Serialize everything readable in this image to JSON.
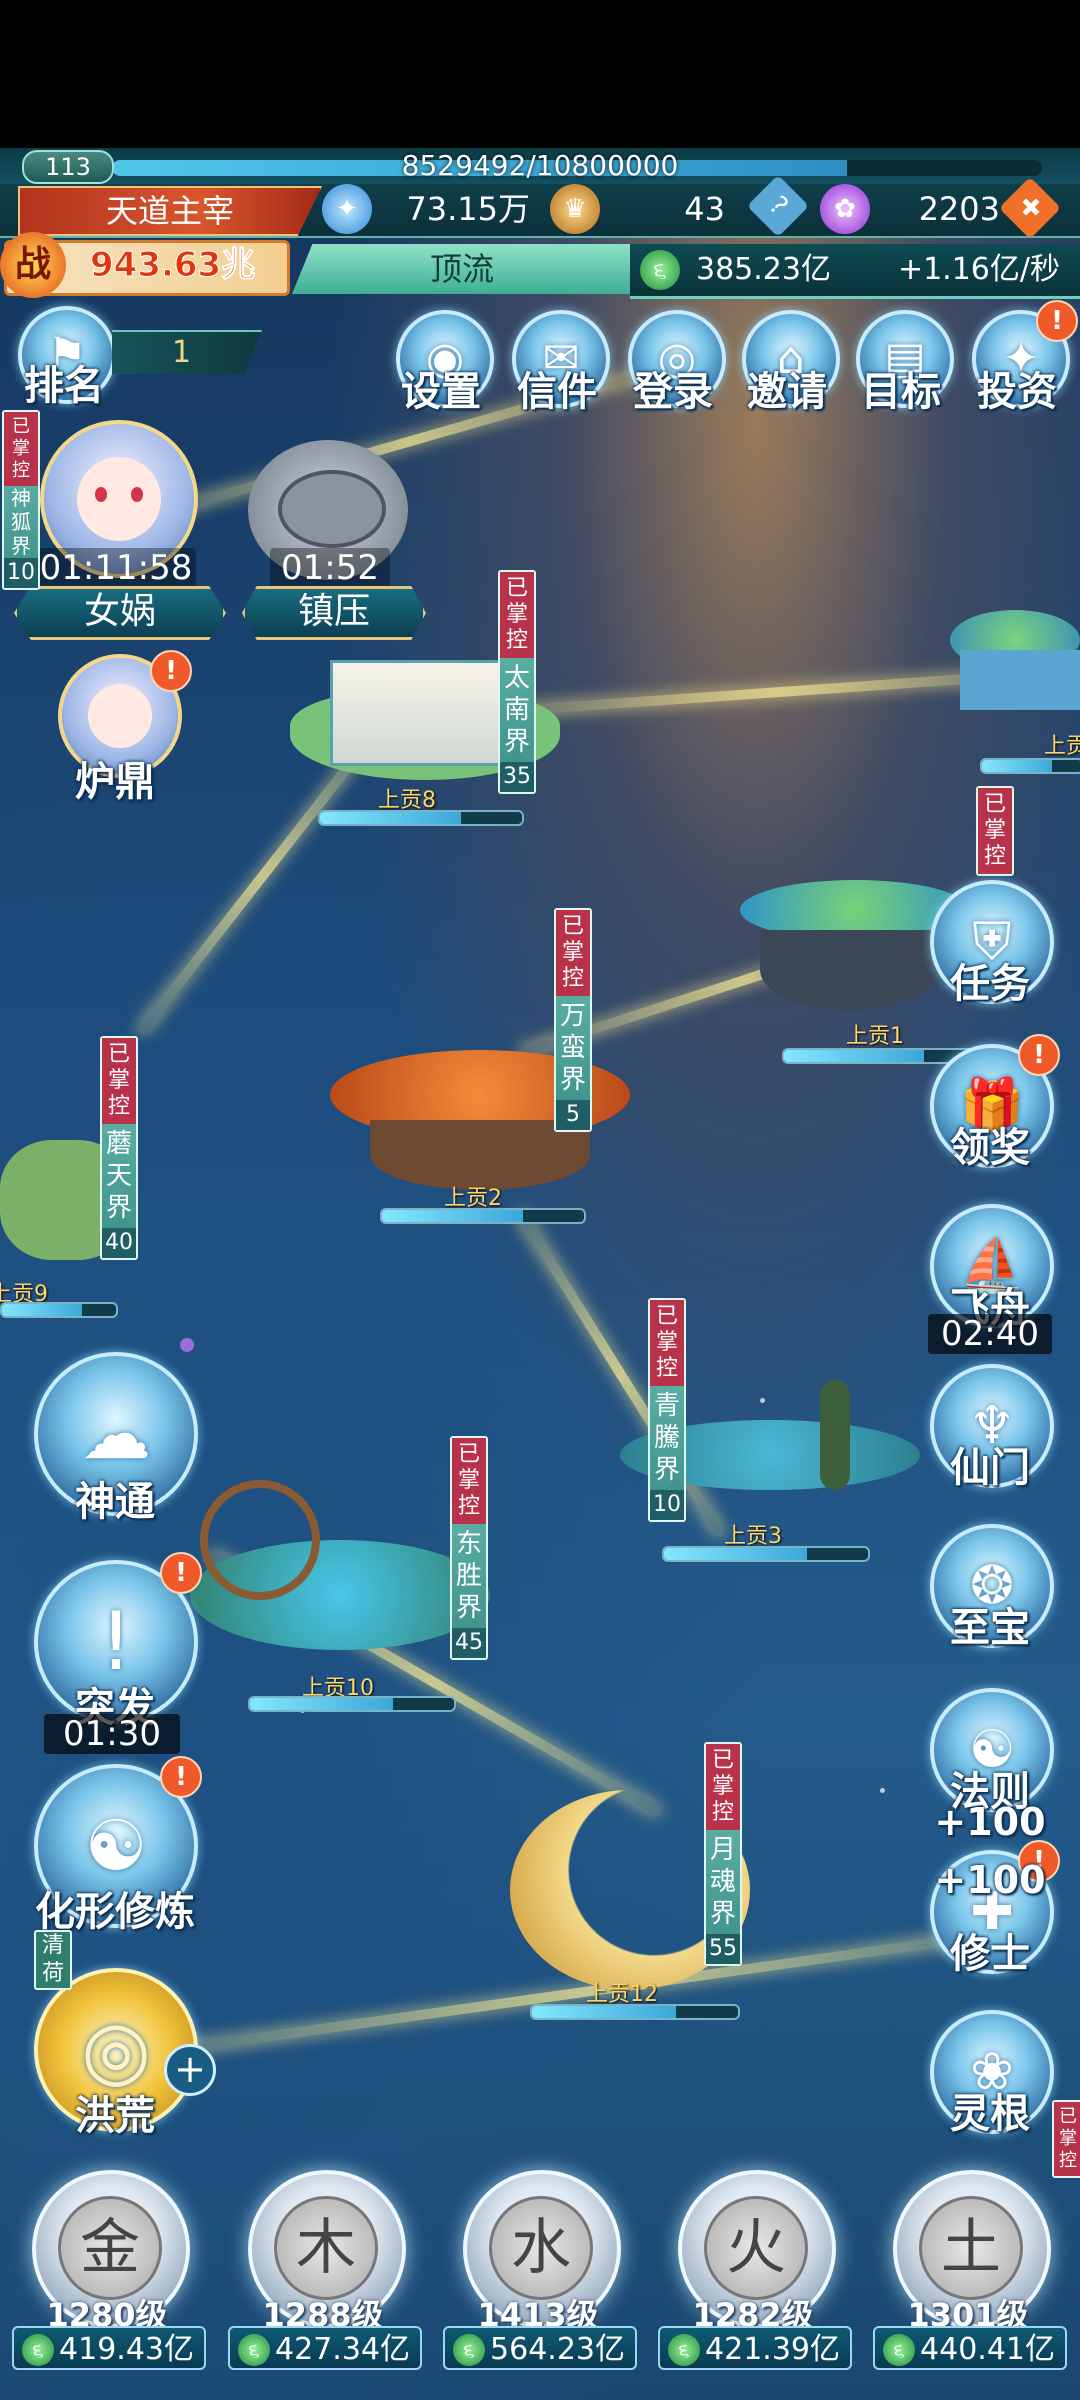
{
  "player": {
    "level": "113",
    "exp": "8529492/10800000",
    "exp_fraction": 0.79,
    "title": "天道主宰",
    "power_prefix": "战",
    "power": "943.63兆",
    "rank_tab": "顶流"
  },
  "resources": {
    "spirit": "73.15万",
    "beast": "43",
    "purple": "2203",
    "income_total": "385.23亿",
    "income_rate": "+1.16亿/秒"
  },
  "icons": {
    "help": "?",
    "add": "✚",
    "coin": "૬"
  },
  "rank": {
    "label": "排名",
    "value": "1"
  },
  "top_menu": [
    {
      "label": "设置"
    },
    {
      "label": "信件"
    },
    {
      "label": "登录"
    },
    {
      "label": "邀请"
    },
    {
      "label": "目标"
    },
    {
      "label": "投资"
    }
  ],
  "characters": {
    "nuwa": {
      "timer": "01:11:58",
      "name": "女娲"
    },
    "zhenya": {
      "timer": "01:52",
      "name": "镇压"
    },
    "luding": {
      "name": "炉鼎"
    },
    "side_tag": "已掌控",
    "side_realm": "神狐界",
    "side_num": "10"
  },
  "realms": [
    {
      "head": "已掌控",
      "name": "太南界",
      "num": "35",
      "label": "上贡8"
    },
    {
      "head": "已掌控",
      "name": "万蛮界",
      "num": "5",
      "label": "上贡2"
    },
    {
      "head": "已掌控",
      "name": "蘑天界",
      "num": "40",
      "label": "上贡9"
    },
    {
      "head": "已掌控",
      "name": "青騰界",
      "num": "10",
      "label": "上贡3"
    },
    {
      "head": "已掌控",
      "name": "东胜界",
      "num": "45",
      "label": "上贡10"
    },
    {
      "head": "已掌控",
      "name": "月魂界",
      "num": "55",
      "label": "上贡12"
    },
    {
      "head": "已掌控",
      "label": "上贡1"
    },
    {
      "label": "上贡"
    }
  ],
  "left_menu": {
    "shentong": "神通",
    "tufa": {
      "label": "突发",
      "timer": "01:30"
    },
    "huaxing": "化形修炼",
    "honghuang": "洪荒",
    "side_partial": "清荷"
  },
  "right_menu": {
    "renwu": "任务",
    "lingjiang": "领奖",
    "feizhou": {
      "label": "飞舟",
      "timer": "02:40"
    },
    "xianmen": "仙门",
    "zhibao": "至宝",
    "faze": {
      "label": "法则",
      "bonus": "+100"
    },
    "xiushi": {
      "label": "修士",
      "bonus": "+100"
    },
    "linggen": "灵根",
    "far_right_tag": "已掌控"
  },
  "badges": {
    "count": "!"
  },
  "elements": [
    {
      "symbol": "金",
      "level": "1280级",
      "value": "419.43亿"
    },
    {
      "symbol": "木",
      "level": "1288级",
      "value": "427.34亿"
    },
    {
      "symbol": "水",
      "level": "1413级",
      "value": "564.23亿"
    },
    {
      "symbol": "火",
      "level": "1282级",
      "value": "421.39亿"
    },
    {
      "symbol": "土",
      "level": "1301级",
      "value": "440.41亿"
    }
  ]
}
